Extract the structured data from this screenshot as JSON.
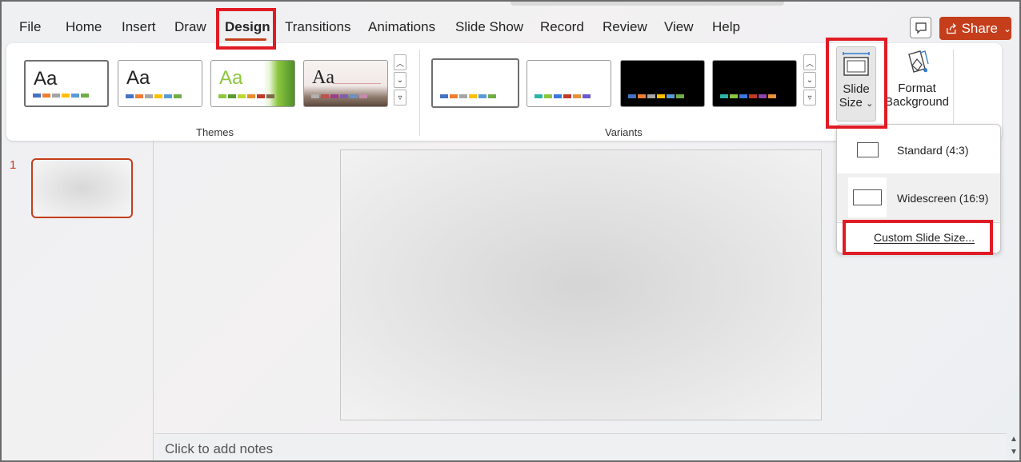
{
  "menu": {
    "tabs": [
      "File",
      "Home",
      "Insert",
      "Draw",
      "Design",
      "Transitions",
      "Animations",
      "Slide Show",
      "Record",
      "Review",
      "View",
      "Help"
    ],
    "active_tab": "Design",
    "share_label": "Share"
  },
  "ribbon": {
    "themes": {
      "label": "Themes",
      "items": [
        {
          "aa": "Aa",
          "aa_color": "#222222",
          "swatches": [
            "#4472c4",
            "#ed7d31",
            "#a5a5a5",
            "#ffc000",
            "#5b9bd5",
            "#70ad47"
          ]
        },
        {
          "aa": "Aa",
          "aa_color": "#222222",
          "swatches": [
            "#4472c4",
            "#ed7d31",
            "#a5a5a5",
            "#ffc000",
            "#5b9bd5",
            "#70ad47"
          ]
        },
        {
          "aa": "Aa",
          "aa_color": "#8cc63f",
          "swatches": [
            "#8cc63f",
            "#5a9a2f",
            "#bfd730",
            "#e98c2c",
            "#c0392b",
            "#7f6a4d"
          ]
        },
        {
          "aa": "Aa",
          "aa_color": "#2b2b2b",
          "swatches": [
            "#b0b0b0",
            "#c0504d",
            "#9c3d8a",
            "#7f5fa8",
            "#6f8fc2",
            "#c48ab0"
          ]
        }
      ]
    },
    "variants": {
      "label": "Variants",
      "items": [
        {
          "bg": "#ffffff",
          "swatches": [
            "#4472c4",
            "#ed7d31",
            "#a5a5a5",
            "#ffc000",
            "#5b9bd5",
            "#70ad47"
          ]
        },
        {
          "bg": "#ffffff",
          "swatches": [
            "#2ab5a8",
            "#8cc63f",
            "#3c78d8",
            "#c0392b",
            "#e69138",
            "#6a5acd"
          ]
        },
        {
          "bg": "#000000",
          "swatches": [
            "#4472c4",
            "#ed7d31",
            "#a5a5a5",
            "#ffc000",
            "#5b9bd5",
            "#70ad47"
          ]
        },
        {
          "bg": "#000000",
          "swatches": [
            "#2ab5a8",
            "#8cc63f",
            "#3c78d8",
            "#c0392b",
            "#8e44ad",
            "#e69138"
          ]
        }
      ]
    },
    "slide_size": {
      "line1": "Slide",
      "line2": "Size",
      "chevron": "⌄"
    },
    "format_background": {
      "line1": "Format",
      "line2": "Background"
    }
  },
  "slides": {
    "number": "1"
  },
  "notes": {
    "placeholder": "Click to add notes"
  },
  "dropdown": {
    "standard": "Standard (4:3)",
    "widescreen": "Widescreen (16:9)",
    "custom": "Custom Slide Size..."
  },
  "colors": {
    "accent": "#c43e1c",
    "highlight": "#e01b24"
  }
}
